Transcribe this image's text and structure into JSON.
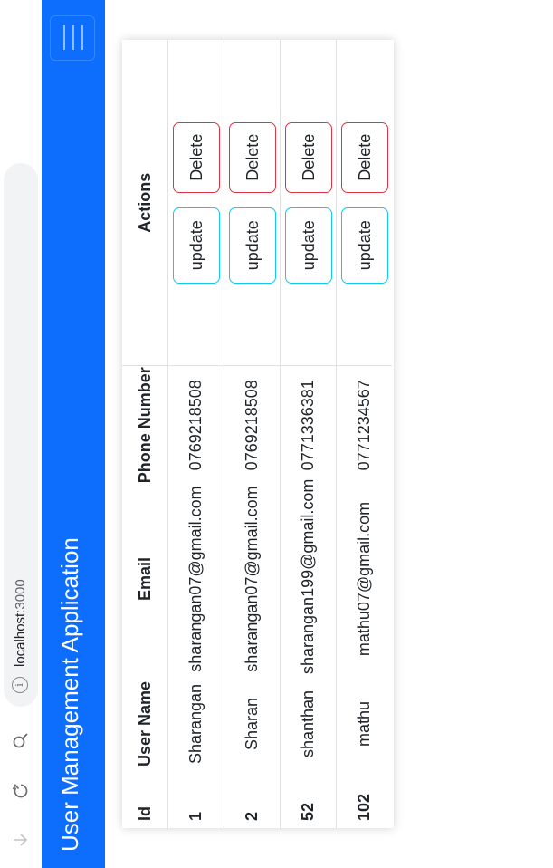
{
  "browser": {
    "url_host": "localhost",
    "url_port": ":3000",
    "icons": {
      "download": "download-arrow-icon",
      "reload": "reload-icon",
      "zoom": "zoom-icon",
      "info": "info-icon"
    }
  },
  "navbar": {
    "brand": "User Management Application",
    "menu_icon": "hamburger-menu-icon",
    "color": "#0d6efd"
  },
  "table": {
    "headers": {
      "id": "Id",
      "username": "User Name",
      "email": "Email",
      "phone": "Phone Number",
      "actions": "Actions"
    },
    "rows": [
      {
        "id": "1",
        "username": "Sharangan",
        "email": "sharangan07@gmail.com",
        "phone": "0769218508",
        "update": "update",
        "delete": "Delete"
      },
      {
        "id": "2",
        "username": "Sharan",
        "email": "sharangan07@gmail.com",
        "phone": "0769218508",
        "update": "update",
        "delete": "Delete"
      },
      {
        "id": "52",
        "username": "shanthan",
        "email": "sharangan199@gmail.com",
        "phone": "0771336381",
        "update": "update",
        "delete": "Delete"
      },
      {
        "id": "102",
        "username": "mathu",
        "email": "mathu07@gmail.com",
        "phone": "0771234567",
        "update": "update",
        "delete": "Delete"
      }
    ],
    "colors": {
      "update_border": "#0dcaf0",
      "delete_border": "#dc3545"
    }
  }
}
